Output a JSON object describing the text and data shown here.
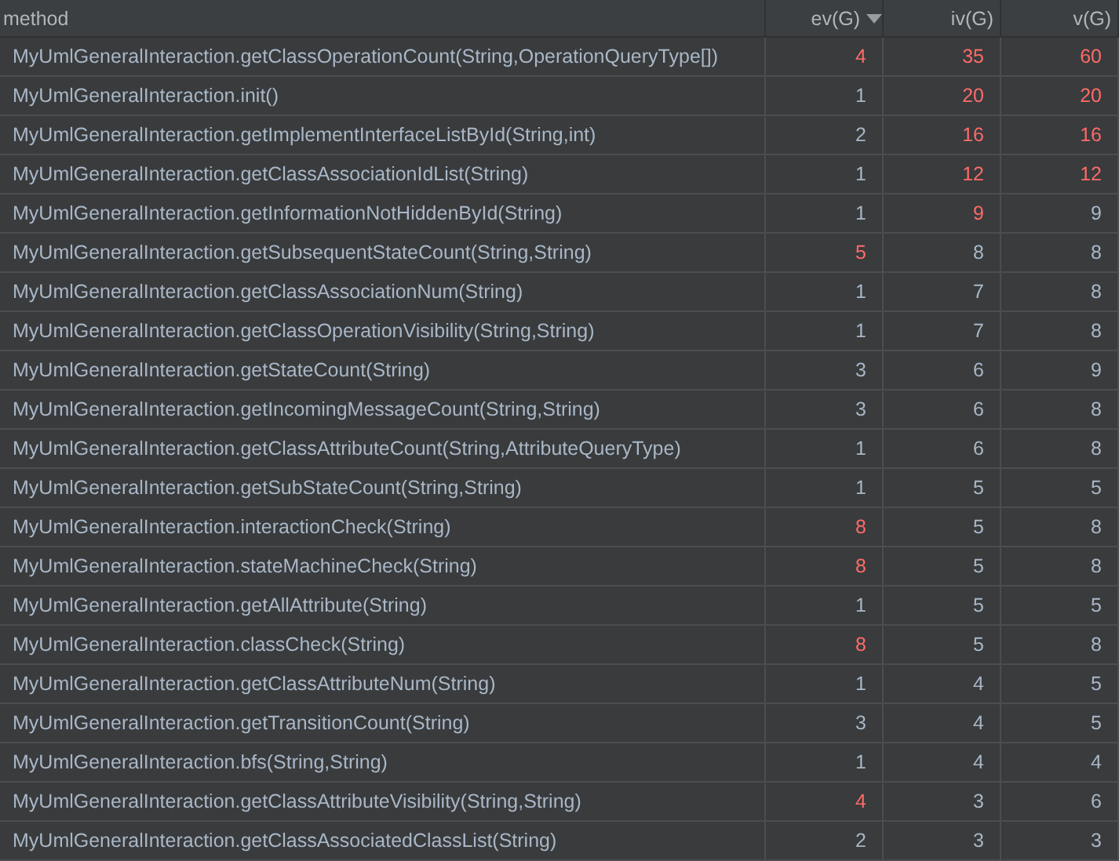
{
  "table": {
    "columns": [
      {
        "label": "method",
        "sorted": false
      },
      {
        "label": "ev(G)",
        "sorted": true
      },
      {
        "label": "iv(G)",
        "sorted": false
      },
      {
        "label": "v(G)",
        "sorted": false
      }
    ],
    "rows": [
      {
        "method": "MyUmlGeneralInteraction.getClassOperationCount(String,OperationQueryType[])",
        "values": [
          {
            "text": "4",
            "flagged": true
          },
          {
            "text": "35",
            "flagged": true
          },
          {
            "text": "60",
            "flagged": true
          }
        ]
      },
      {
        "method": "MyUmlGeneralInteraction.init()",
        "values": [
          {
            "text": "1",
            "flagged": false
          },
          {
            "text": "20",
            "flagged": true
          },
          {
            "text": "20",
            "flagged": true
          }
        ]
      },
      {
        "method": "MyUmlGeneralInteraction.getImplementInterfaceListById(String,int)",
        "values": [
          {
            "text": "2",
            "flagged": false
          },
          {
            "text": "16",
            "flagged": true
          },
          {
            "text": "16",
            "flagged": true
          }
        ]
      },
      {
        "method": "MyUmlGeneralInteraction.getClassAssociationIdList(String)",
        "values": [
          {
            "text": "1",
            "flagged": false
          },
          {
            "text": "12",
            "flagged": true
          },
          {
            "text": "12",
            "flagged": true
          }
        ]
      },
      {
        "method": "MyUmlGeneralInteraction.getInformationNotHiddenById(String)",
        "values": [
          {
            "text": "1",
            "flagged": false
          },
          {
            "text": "9",
            "flagged": true
          },
          {
            "text": "9",
            "flagged": false
          }
        ]
      },
      {
        "method": "MyUmlGeneralInteraction.getSubsequentStateCount(String,String)",
        "values": [
          {
            "text": "5",
            "flagged": true
          },
          {
            "text": "8",
            "flagged": false
          },
          {
            "text": "8",
            "flagged": false
          }
        ]
      },
      {
        "method": "MyUmlGeneralInteraction.getClassAssociationNum(String)",
        "values": [
          {
            "text": "1",
            "flagged": false
          },
          {
            "text": "7",
            "flagged": false
          },
          {
            "text": "8",
            "flagged": false
          }
        ]
      },
      {
        "method": "MyUmlGeneralInteraction.getClassOperationVisibility(String,String)",
        "values": [
          {
            "text": "1",
            "flagged": false
          },
          {
            "text": "7",
            "flagged": false
          },
          {
            "text": "8",
            "flagged": false
          }
        ]
      },
      {
        "method": "MyUmlGeneralInteraction.getStateCount(String)",
        "values": [
          {
            "text": "3",
            "flagged": false
          },
          {
            "text": "6",
            "flagged": false
          },
          {
            "text": "9",
            "flagged": false
          }
        ]
      },
      {
        "method": "MyUmlGeneralInteraction.getIncomingMessageCount(String,String)",
        "values": [
          {
            "text": "3",
            "flagged": false
          },
          {
            "text": "6",
            "flagged": false
          },
          {
            "text": "8",
            "flagged": false
          }
        ]
      },
      {
        "method": "MyUmlGeneralInteraction.getClassAttributeCount(String,AttributeQueryType)",
        "values": [
          {
            "text": "1",
            "flagged": false
          },
          {
            "text": "6",
            "flagged": false
          },
          {
            "text": "8",
            "flagged": false
          }
        ]
      },
      {
        "method": "MyUmlGeneralInteraction.getSubStateCount(String,String)",
        "values": [
          {
            "text": "1",
            "flagged": false
          },
          {
            "text": "5",
            "flagged": false
          },
          {
            "text": "5",
            "flagged": false
          }
        ]
      },
      {
        "method": "MyUmlGeneralInteraction.interactionCheck(String)",
        "values": [
          {
            "text": "8",
            "flagged": true
          },
          {
            "text": "5",
            "flagged": false
          },
          {
            "text": "8",
            "flagged": false
          }
        ]
      },
      {
        "method": "MyUmlGeneralInteraction.stateMachineCheck(String)",
        "values": [
          {
            "text": "8",
            "flagged": true
          },
          {
            "text": "5",
            "flagged": false
          },
          {
            "text": "8",
            "flagged": false
          }
        ]
      },
      {
        "method": "MyUmlGeneralInteraction.getAllAttribute(String)",
        "values": [
          {
            "text": "1",
            "flagged": false
          },
          {
            "text": "5",
            "flagged": false
          },
          {
            "text": "5",
            "flagged": false
          }
        ]
      },
      {
        "method": "MyUmlGeneralInteraction.classCheck(String)",
        "values": [
          {
            "text": "8",
            "flagged": true
          },
          {
            "text": "5",
            "flagged": false
          },
          {
            "text": "8",
            "flagged": false
          }
        ]
      },
      {
        "method": "MyUmlGeneralInteraction.getClassAttributeNum(String)",
        "values": [
          {
            "text": "1",
            "flagged": false
          },
          {
            "text": "4",
            "flagged": false
          },
          {
            "text": "5",
            "flagged": false
          }
        ]
      },
      {
        "method": "MyUmlGeneralInteraction.getTransitionCount(String)",
        "values": [
          {
            "text": "3",
            "flagged": false
          },
          {
            "text": "4",
            "flagged": false
          },
          {
            "text": "5",
            "flagged": false
          }
        ]
      },
      {
        "method": "MyUmlGeneralInteraction.bfs(String,String)",
        "values": [
          {
            "text": "1",
            "flagged": false
          },
          {
            "text": "4",
            "flagged": false
          },
          {
            "text": "4",
            "flagged": false
          }
        ]
      },
      {
        "method": "MyUmlGeneralInteraction.getClassAttributeVisibility(String,String)",
        "values": [
          {
            "text": "4",
            "flagged": true
          },
          {
            "text": "3",
            "flagged": false
          },
          {
            "text": "6",
            "flagged": false
          }
        ]
      },
      {
        "method": "MyUmlGeneralInteraction.getClassAssociatedClassList(String)",
        "values": [
          {
            "text": "2",
            "flagged": false
          },
          {
            "text": "3",
            "flagged": false
          },
          {
            "text": "3",
            "flagged": false
          }
        ]
      }
    ]
  }
}
